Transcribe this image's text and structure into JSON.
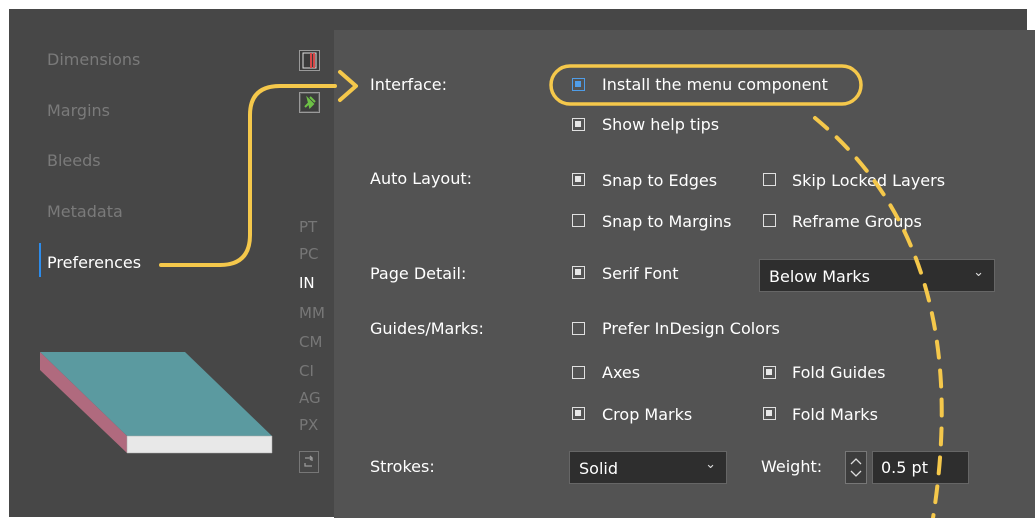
{
  "sidebar": {
    "items": [
      {
        "label": "Dimensions",
        "active": false
      },
      {
        "label": "Margins",
        "active": false
      },
      {
        "label": "Bleeds",
        "active": false
      },
      {
        "label": "Metadata",
        "active": false
      },
      {
        "label": "Preferences",
        "active": true
      }
    ]
  },
  "units": {
    "items": [
      "PT",
      "PC",
      "IN",
      "MM",
      "CM",
      "CI",
      "AG",
      "PX"
    ],
    "selected": "IN"
  },
  "interface": {
    "label": "Interface:",
    "install_menu": {
      "label": "Install the menu component",
      "checked": true
    },
    "help_tips": {
      "label": "Show help tips",
      "checked": true
    }
  },
  "auto_layout": {
    "label": "Auto Layout:",
    "snap_edges": {
      "label": "Snap to Edges",
      "checked": true
    },
    "skip_locked": {
      "label": "Skip Locked Layers",
      "checked": false
    },
    "snap_margins": {
      "label": "Snap to Margins",
      "checked": false
    },
    "reframe_groups": {
      "label": "Reframe Groups",
      "checked": false
    }
  },
  "page_detail": {
    "label": "Page Detail:",
    "serif_font": {
      "label": "Serif Font",
      "checked": true
    },
    "position": {
      "value": "Below Marks"
    }
  },
  "guides": {
    "label": "Guides/Marks:",
    "prefer_colors": {
      "label": "Prefer InDesign Colors",
      "checked": false
    },
    "axes": {
      "label": "Axes",
      "checked": false
    },
    "fold_guides": {
      "label": "Fold Guides",
      "checked": true
    },
    "crop_marks": {
      "label": "Crop Marks",
      "checked": true
    },
    "fold_marks": {
      "label": "Fold Marks",
      "checked": true
    }
  },
  "strokes": {
    "label": "Strokes:",
    "style": {
      "value": "Solid"
    },
    "weight_label": "Weight:",
    "weight_value": "0.5 pt"
  },
  "colors": {
    "accent": "#2d8ceb",
    "annotation": "#f5c84b",
    "book_top": "#5b9aa0",
    "book_side": "#b06a7e"
  }
}
